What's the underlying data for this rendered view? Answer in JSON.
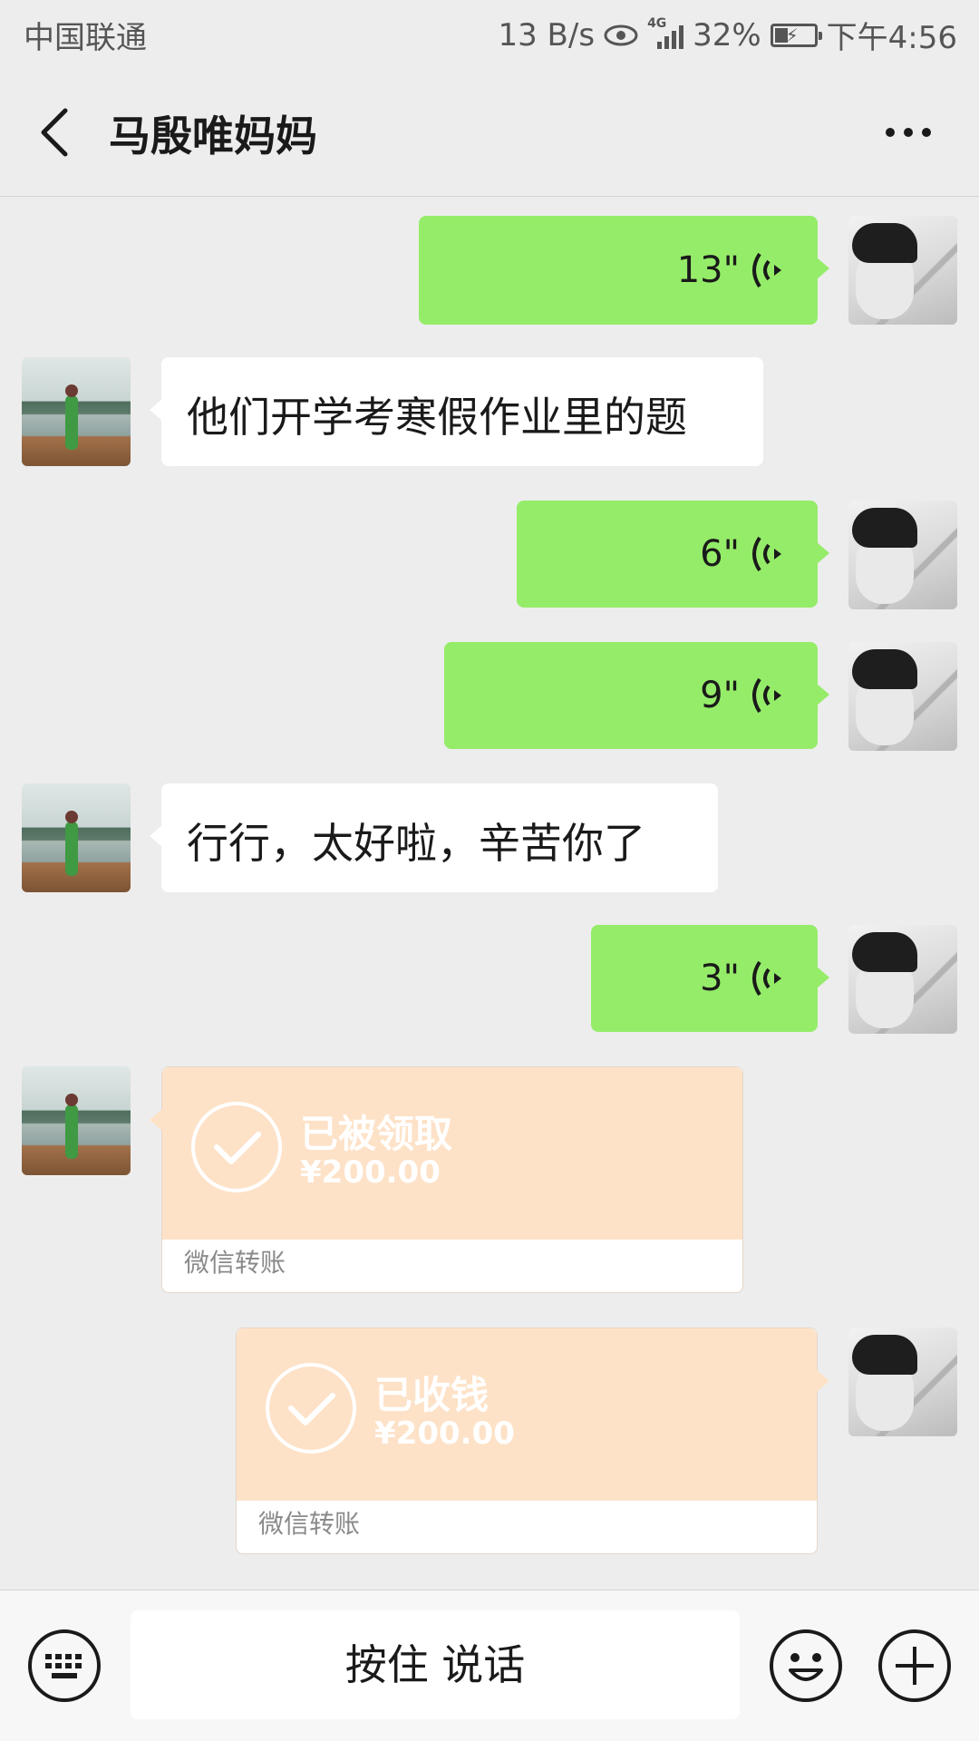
{
  "status_bar": {
    "carrier": "中国联通",
    "speed": "13 B/s",
    "network": "4G",
    "battery": "32%",
    "time": "下午4:56"
  },
  "header": {
    "title": "马殷唯妈妈",
    "back_icon": "chevron-left-icon",
    "more_icon": "more-dots-icon"
  },
  "messages": [
    {
      "side": "right",
      "type": "voice",
      "duration": "13\""
    },
    {
      "side": "left",
      "type": "text",
      "text": "他们开学考寒假作业里的题"
    },
    {
      "side": "right",
      "type": "voice",
      "duration": "6\""
    },
    {
      "side": "right",
      "type": "voice",
      "duration": "9\""
    },
    {
      "side": "left",
      "type": "text",
      "text": "行行，太好啦，辛苦你了"
    },
    {
      "side": "right",
      "type": "voice",
      "duration": "3\""
    },
    {
      "side": "left",
      "type": "transfer",
      "status": "已被领取",
      "amount": "¥200.00",
      "label": "微信转账"
    },
    {
      "side": "right",
      "type": "transfer",
      "status": "已收钱",
      "amount": "¥200.00",
      "label": "微信转账"
    }
  ],
  "input_bar": {
    "hold_to_talk": "按住 说话",
    "keyboard_icon": "keyboard-icon",
    "emoji_icon": "emoji-icon",
    "plus_icon": "plus-icon"
  },
  "colors": {
    "background": "#ededed",
    "self_bubble": "#95ec69",
    "other_bubble": "#ffffff",
    "transfer_card": "#fde2c8"
  }
}
